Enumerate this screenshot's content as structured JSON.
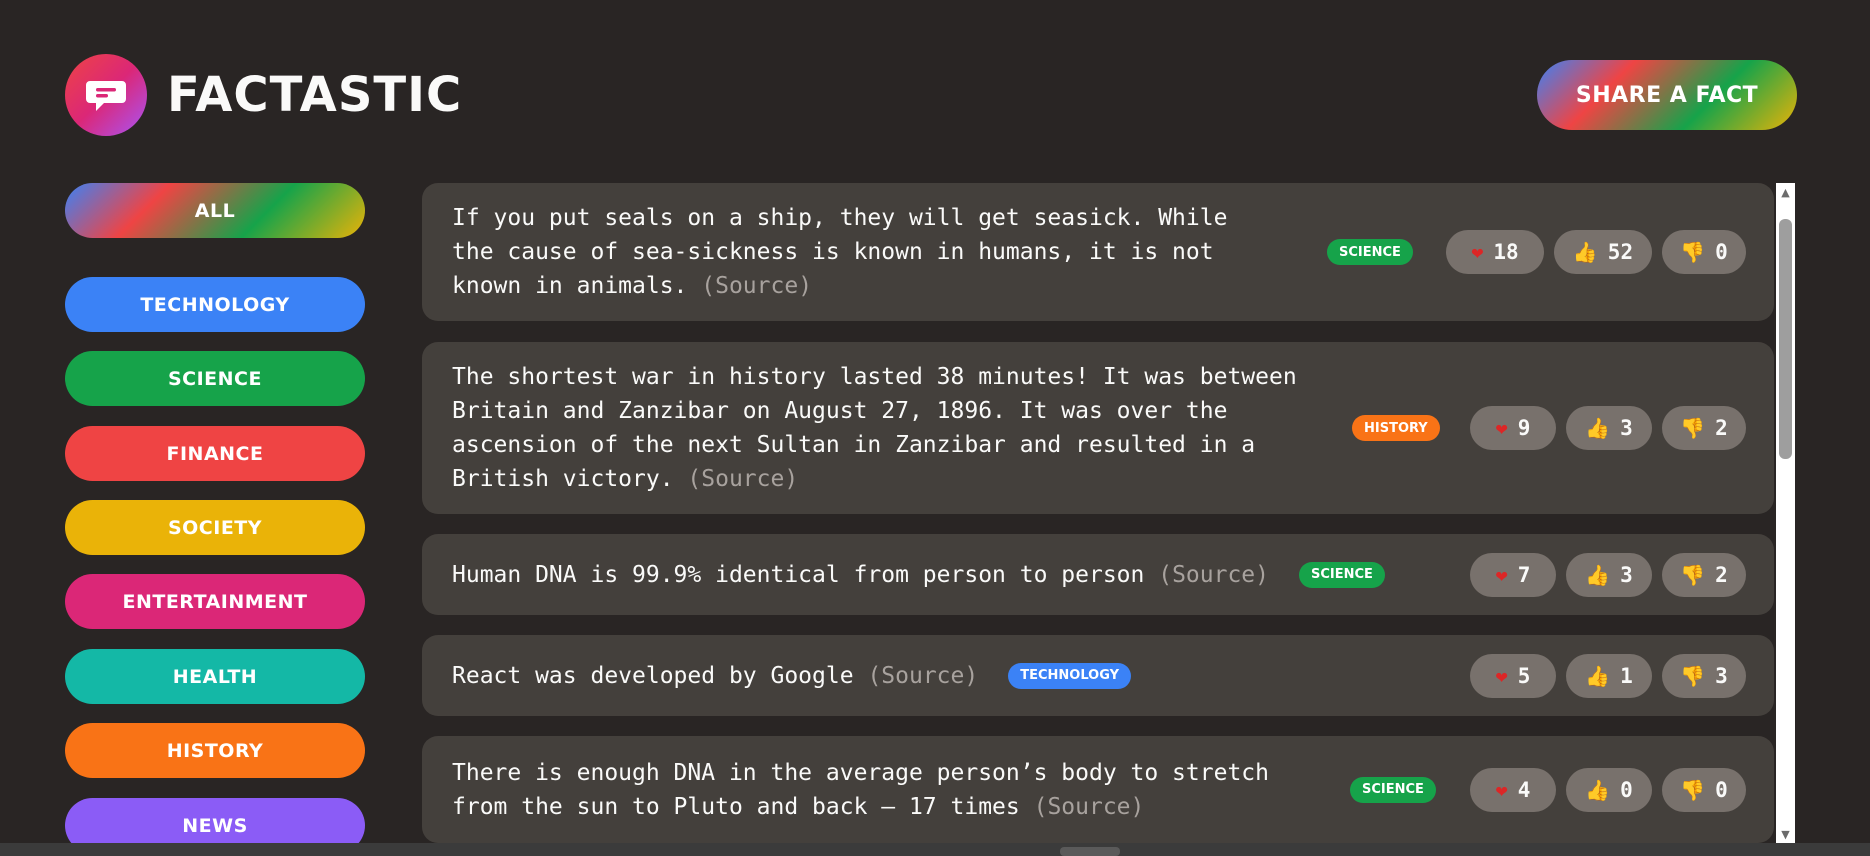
{
  "app": {
    "title": "FACTASTIC",
    "share_label": "SHARE A FACT"
  },
  "colors": {
    "technology": "#3b82f6",
    "science": "#16a34a",
    "finance": "#ef4444",
    "society": "#eab308",
    "entertainment": "#db2777",
    "health": "#14b8a6",
    "history": "#f97316",
    "news": "#8b5cf6"
  },
  "categories": [
    {
      "label": "ALL",
      "color": "gradient"
    },
    {
      "label": "TECHNOLOGY",
      "color": "#3b82f6"
    },
    {
      "label": "SCIENCE",
      "color": "#16a34a"
    },
    {
      "label": "FINANCE",
      "color": "#ef4444"
    },
    {
      "label": "SOCIETY",
      "color": "#eab308"
    },
    {
      "label": "ENTERTAINMENT",
      "color": "#db2777"
    },
    {
      "label": "HEALTH",
      "color": "#14b8a6"
    },
    {
      "label": "HISTORY",
      "color": "#f97316"
    },
    {
      "label": "NEWS",
      "color": "#8b5cf6"
    }
  ],
  "facts": [
    {
      "text": "If you put seals on a ship, they will get seasick. While the cause of sea-sickness is known in humans, it is not known in animals.",
      "source": "(Source)",
      "tag": "SCIENCE",
      "tag_color": "#16a34a",
      "votes": {
        "heart": "18",
        "up": "52",
        "down": "0"
      }
    },
    {
      "text": "The shortest war in history lasted 38 minutes! It was between Britain and Zanzibar on August 27, 1896. It was over the ascension of the next Sultan in Zanzibar and resulted in a British victory.",
      "source": "(Source)",
      "tag": "HISTORY",
      "tag_color": "#f97316",
      "votes": {
        "heart": "9",
        "up": "3",
        "down": "2"
      }
    },
    {
      "text": "Human DNA is 99.9% identical from person to person",
      "source": "(Source)",
      "tag": "SCIENCE",
      "tag_color": "#16a34a",
      "votes": {
        "heart": "7",
        "up": "3",
        "down": "2"
      }
    },
    {
      "text": "React was developed by Google",
      "source": "(Source)",
      "tag": "TECHNOLOGY",
      "tag_color": "#3b82f6",
      "votes": {
        "heart": "5",
        "up": "1",
        "down": "3"
      }
    },
    {
      "text": "There is enough DNA in the average person’s body to stretch from the sun to Pluto and back — 17 times",
      "source": "(Source)",
      "tag": "SCIENCE",
      "tag_color": "#16a34a",
      "votes": {
        "heart": "4",
        "up": "0",
        "down": "0"
      }
    }
  ],
  "icons": {
    "logo": "chat-bubble-icon",
    "heart": "heart-icon",
    "up": "thumbs-up-icon",
    "down": "thumbs-down-icon"
  }
}
